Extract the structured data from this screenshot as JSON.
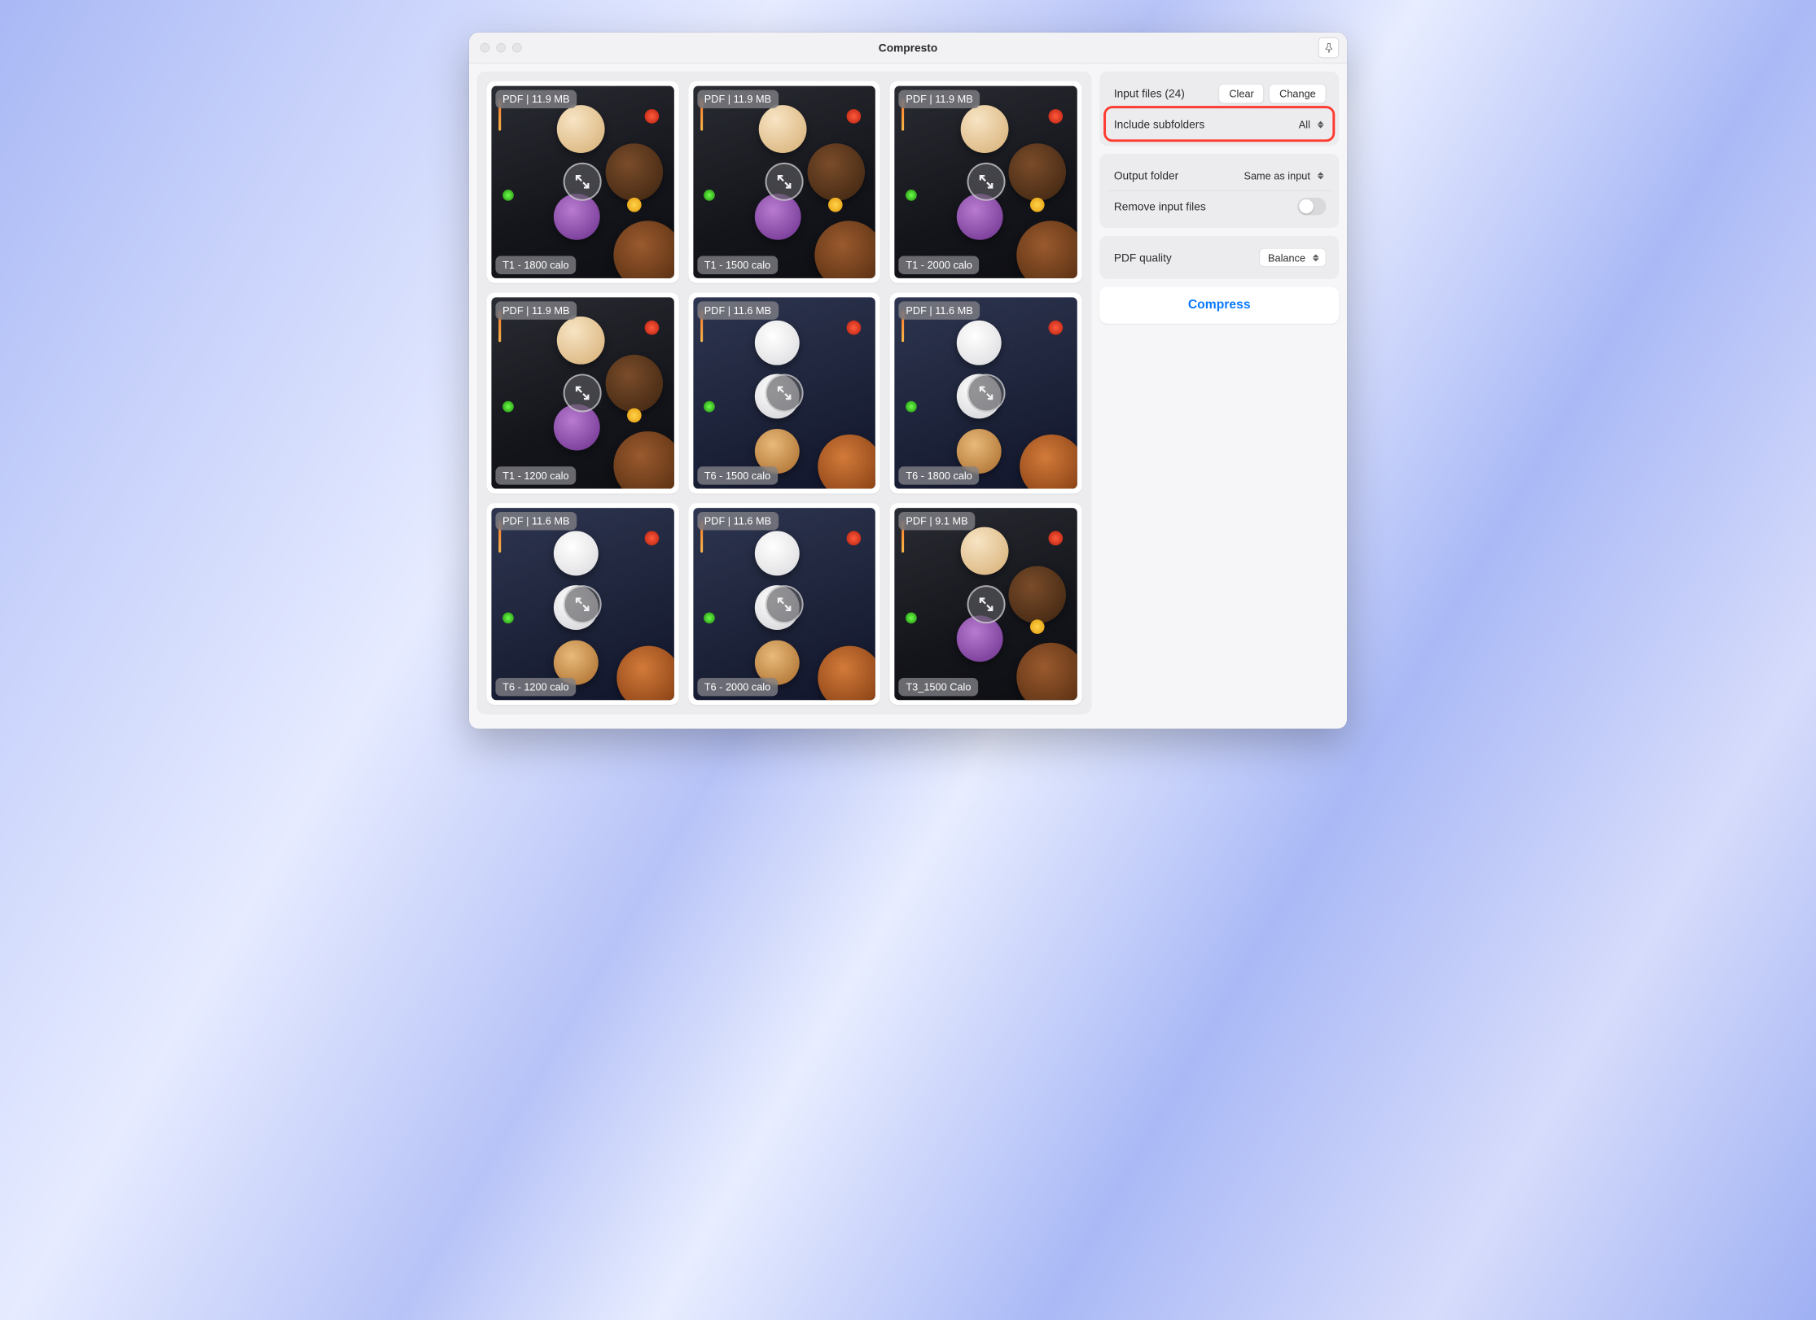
{
  "app": {
    "title": "Compresto"
  },
  "sidebar": {
    "input_label": "Input files (24)",
    "clear": "Clear",
    "change": "Change",
    "include_subfolders_label": "Include subfolders",
    "include_subfolders_value": "All",
    "output_folder_label": "Output folder",
    "output_folder_value": "Same as input",
    "remove_input_label": "Remove input files",
    "remove_input_on": false,
    "pdf_quality_label": "PDF quality",
    "pdf_quality_value": "Balance",
    "compress": "Compress"
  },
  "tiles": [
    {
      "badge": "PDF | 11.9 MB",
      "name": "T1 - 1800 calo",
      "variant": "dark"
    },
    {
      "badge": "PDF | 11.9 MB",
      "name": "T1 - 1500 calo",
      "variant": "dark"
    },
    {
      "badge": "PDF | 11.9 MB",
      "name": "T1 - 2000 calo",
      "variant": "dark"
    },
    {
      "badge": "PDF | 11.9 MB",
      "name": "T1 - 1200 calo",
      "variant": "dark"
    },
    {
      "badge": "PDF | 11.6 MB",
      "name": "T6 - 1500 calo",
      "variant": "navy"
    },
    {
      "badge": "PDF | 11.6 MB",
      "name": "T6 - 1800 calo",
      "variant": "navy"
    },
    {
      "badge": "PDF | 11.6 MB",
      "name": "T6 - 1200 calo",
      "variant": "navy"
    },
    {
      "badge": "PDF | 11.6 MB",
      "name": "T6 - 2000 calo",
      "variant": "navy"
    },
    {
      "badge": "PDF | 9.1 MB",
      "name": "T3_1500 Calo",
      "variant": "dark"
    }
  ]
}
